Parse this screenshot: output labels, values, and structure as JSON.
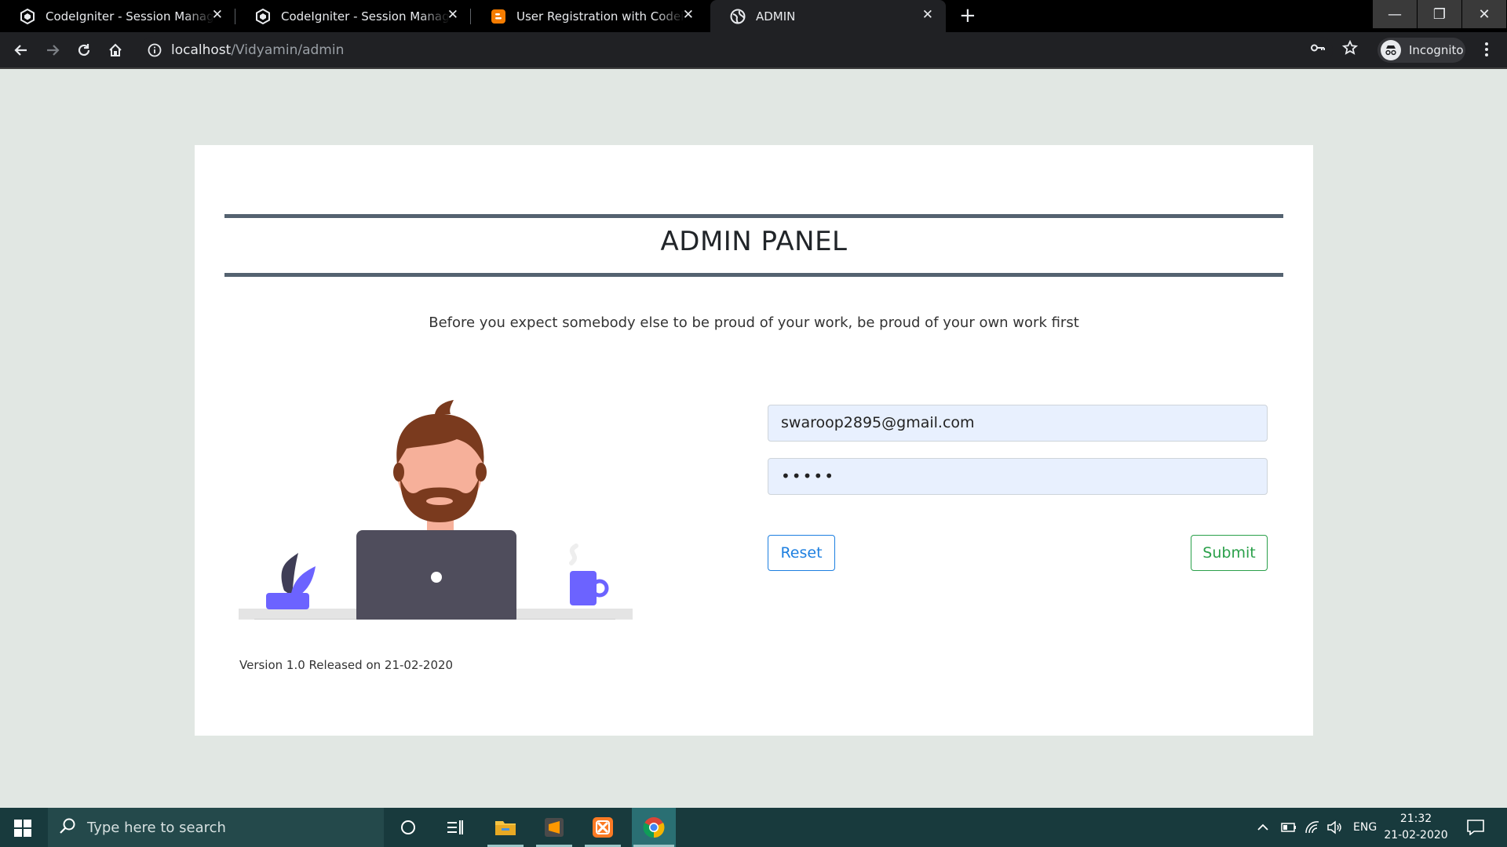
{
  "browser": {
    "tabs": [
      {
        "title": "CodeIgniter - Session Management",
        "favicon": "codeigniter-icon"
      },
      {
        "title": "CodeIgniter - Session Management",
        "favicon": "codeigniter-icon"
      },
      {
        "title": "User Registration with Codeigniter",
        "favicon": "blogger-icon"
      },
      {
        "title": "ADMIN",
        "favicon": "globe-icon",
        "active": true
      }
    ],
    "url_host": "localhost",
    "url_path": "/Vidyamin/admin",
    "profile_label": "Incognito"
  },
  "page": {
    "heading": "ADMIN PANEL",
    "quote": "Before you expect somebody else to be proud of your work, be proud of your own work first",
    "email_value": "swaroop2895@gmail.com",
    "password_mask": "•••••",
    "reset_label": "Reset",
    "submit_label": "Submit",
    "version": "Version 1.0 Released on 21-02-2020"
  },
  "taskbar": {
    "search_placeholder": "Type here to search",
    "language": "ENG",
    "time": "21:32",
    "date": "21-02-2020"
  },
  "colors": {
    "page_bg": "#e1e7e3",
    "rule": "#546270",
    "reset": "#1d7fe0",
    "submit": "#2aa04a",
    "illustration_accent": "#6c63ff"
  }
}
